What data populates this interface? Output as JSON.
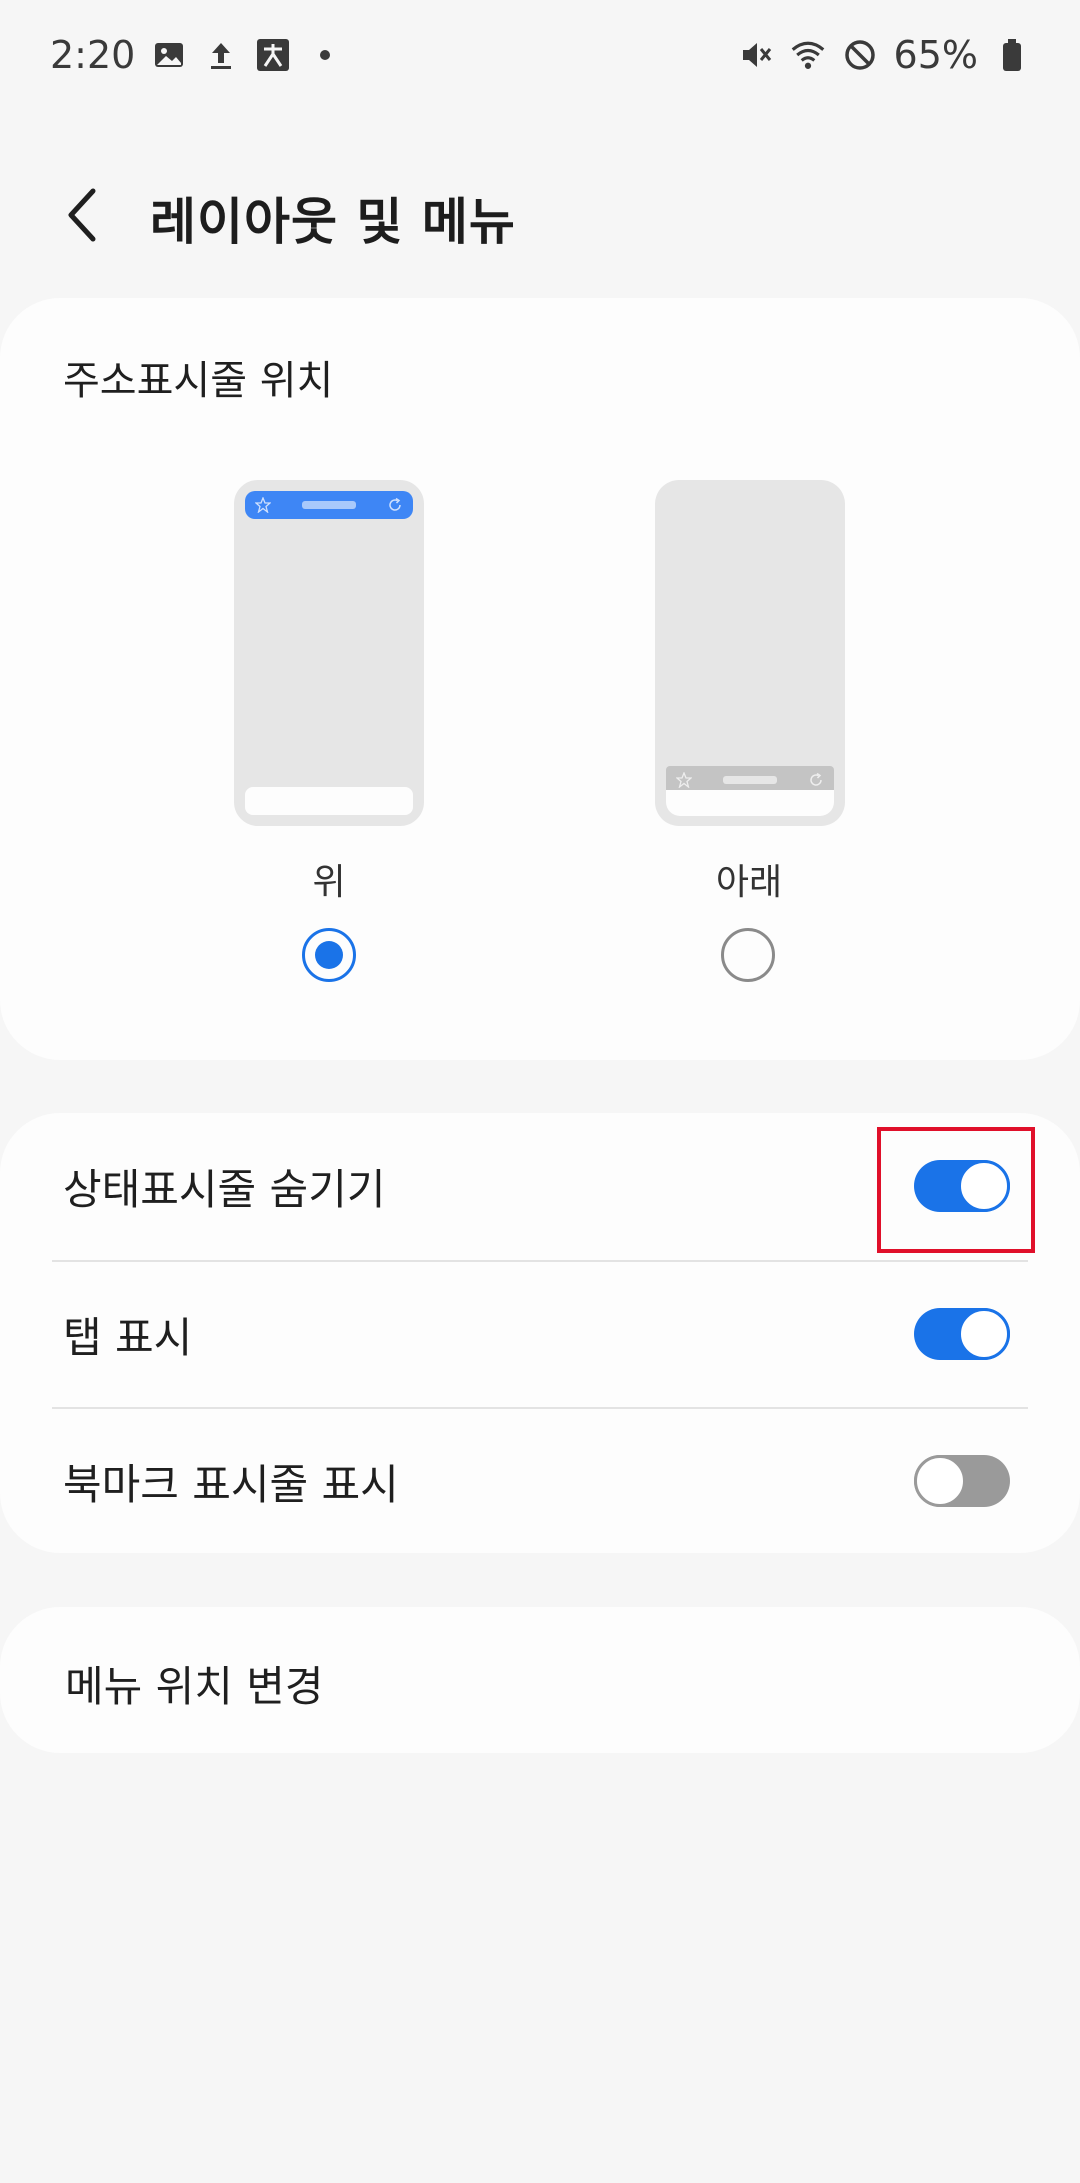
{
  "status_bar": {
    "time": "2:20",
    "left_icons": [
      "gallery-icon",
      "upload-icon",
      "keyboard-icon",
      "dot-icon"
    ],
    "right_icons": [
      "mute-icon",
      "wifi-icon",
      "do-not-disturb-icon"
    ],
    "battery": "65%"
  },
  "header": {
    "title": "레이아웃 및 메뉴"
  },
  "address_bar_position": {
    "title": "주소표시줄 위치",
    "options": [
      {
        "label": "위",
        "selected": true
      },
      {
        "label": "아래",
        "selected": false
      }
    ]
  },
  "toggles": [
    {
      "label": "상태표시줄 숨기기",
      "on": true
    },
    {
      "label": "탭 표시",
      "on": true
    },
    {
      "label": "북마크 표시줄 표시",
      "on": false
    }
  ],
  "menu": {
    "label": "메뉴 위치 변경"
  },
  "colors": {
    "accent": "#1a73e8",
    "highlight": "#e0102a",
    "background": "#f6f6f6",
    "card": "#fdfdfd"
  }
}
